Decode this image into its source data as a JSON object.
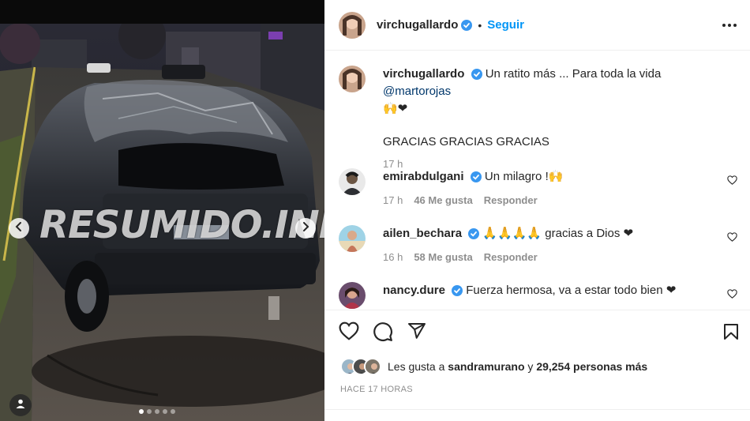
{
  "media": {
    "watermark": "RESUMIDO.INFO",
    "carousel_count": 5,
    "carousel_active": 0
  },
  "post": {
    "author": "virchugallardo",
    "follow_label": "Seguir",
    "follow_separator": "•",
    "caption_before_mention": "Un ratito más ... Para toda la vida ",
    "caption_mention": "@martorojas",
    "caption_emojis": "🙌❤",
    "caption_line2": "GRACIAS GRACIAS GRACIAS",
    "caption_time": "17 h"
  },
  "comments": [
    {
      "user": "emirabdulgani",
      "text": "Un milagro !🙌",
      "time": "17 h",
      "likes": "46 Me gusta",
      "reply": "Responder"
    },
    {
      "user": "ailen_bechara",
      "text": "🙏🙏🙏🙏 gracias a Dios ❤",
      "time": "16 h",
      "likes": "58 Me gusta",
      "reply": "Responder"
    },
    {
      "user": "nancy.dure",
      "text": "Fuerza hermosa, va a estar todo bien ❤",
      "time": "",
      "likes": "",
      "reply": ""
    }
  ],
  "footer": {
    "likes_prefix": "Les gusta a ",
    "likes_user": "sandramurano",
    "likes_middle": " y ",
    "likes_count": "29,254 personas más",
    "time_ago": "HACE 17 HORAS"
  },
  "colors": {
    "accent": "#0095f6",
    "verified": "#3897f0",
    "heart_red": "#ed4956",
    "muted": "#8e8e8e"
  },
  "icons": {
    "like": "heart-icon",
    "comment": "comment-bubble-icon",
    "share": "paper-plane-icon",
    "save": "bookmark-icon",
    "more": "more-dots-icon",
    "verified": "verified-badge-icon",
    "prev": "chevron-left-icon",
    "next": "chevron-right-icon",
    "tag": "user-tag-icon"
  }
}
